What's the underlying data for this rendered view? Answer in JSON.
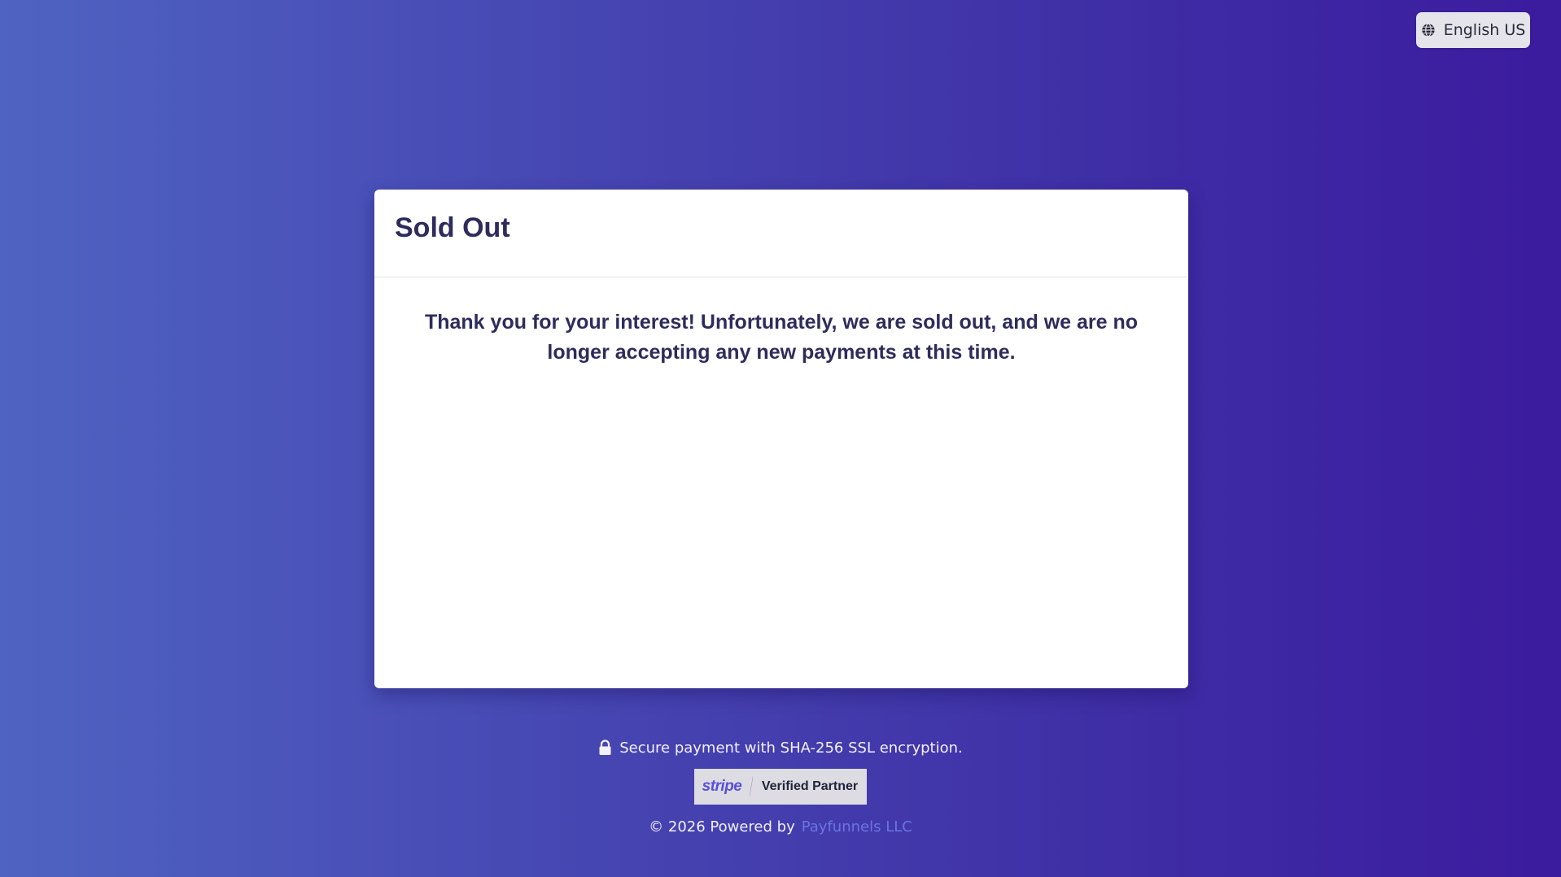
{
  "language_selector": {
    "label": "English US",
    "icon": "globe-icon"
  },
  "card": {
    "title": "Sold Out",
    "message": "Thank you for your interest! Unfortunately, we are sold out, and we are no longer accepting any new payments at this time."
  },
  "footer": {
    "secure_text": "Secure payment with SHA-256 SSL encryption.",
    "secure_icon": "lock-icon",
    "badge": {
      "brand": "stripe",
      "text": "Verified Partner"
    },
    "powered_prefix": "© 2026 Powered by",
    "powered_link": "Payfunnels LLC"
  },
  "colors": {
    "background_start": "#4f63c2",
    "background_end": "#3b1b9e",
    "title_text": "#2e2c5c",
    "link": "#6c74e3",
    "stripe_brand": "#5a4fd8"
  }
}
